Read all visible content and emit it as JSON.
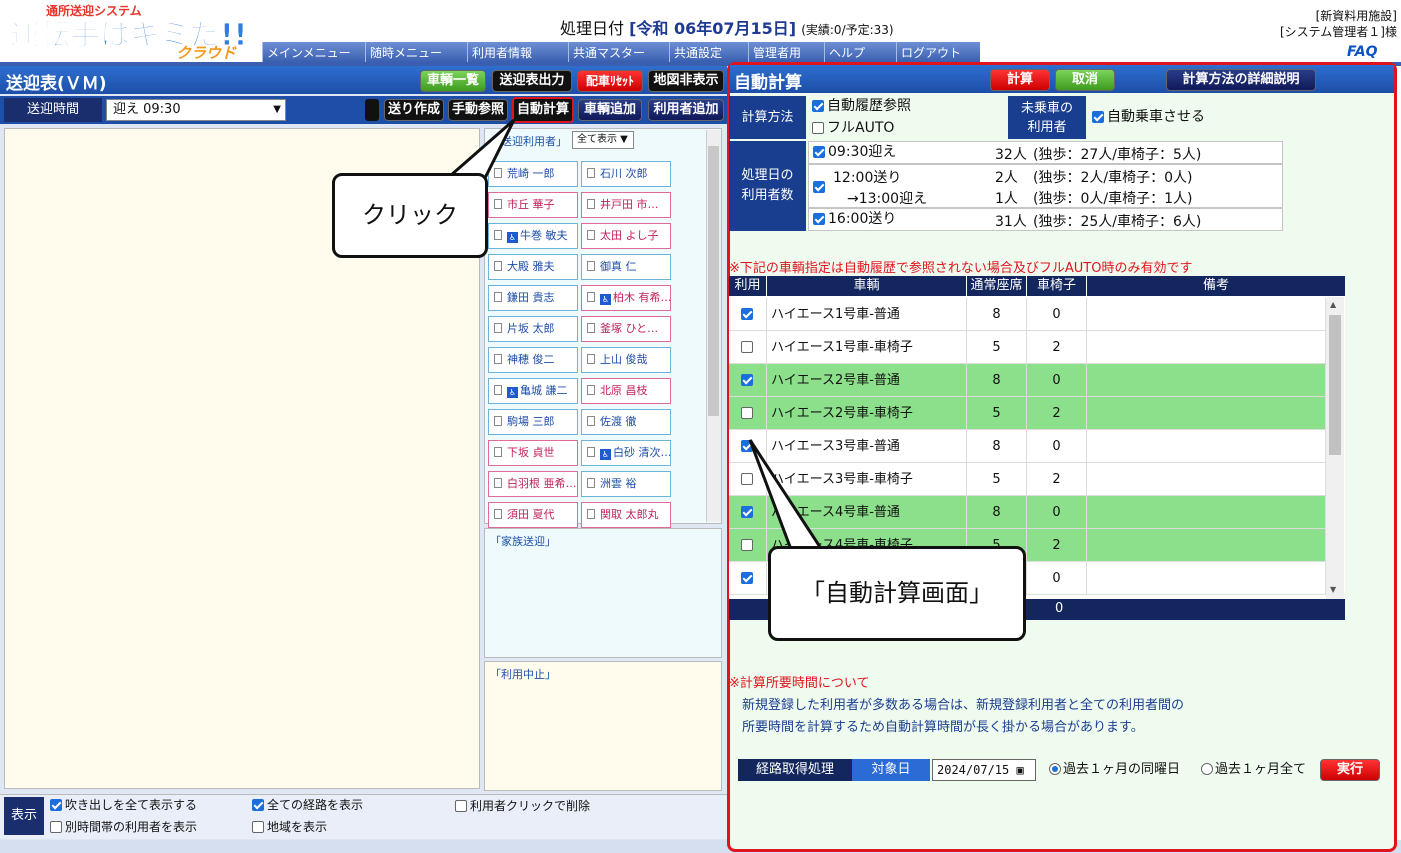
{
  "header": {
    "logo_text_top": "通所送迎システム",
    "logo_text_main": "運転手はキミだ!!",
    "logo_text_sub": "クラウド",
    "processing_label": "処理日付",
    "processing_date": "[令和 06年07月15日]",
    "processing_stats": "(実績:0/予定:33)",
    "facility": "[新資料用施設]",
    "user": "[システム管理者１]様",
    "faq": "FAQ",
    "menu": [
      "メインメニュー",
      "随時メニュー",
      "利用者情報",
      "共通マスター",
      "共通設定",
      "管理者用",
      "ヘルプ",
      "ログアウト"
    ]
  },
  "left": {
    "title": "送迎表(ＶＭ)",
    "top_buttons": [
      "車輌一覧",
      "送迎表出力",
      "配車ﾘｾｯﾄ",
      "地図非表示"
    ],
    "time_label": "送迎時間",
    "time_value": "迎え 09:30",
    "action_buttons": [
      "送り作成",
      "手動参照",
      "自動計算",
      "車輌追加",
      "利用者追加"
    ],
    "user_list_label": "「送迎利用者」",
    "filter_value": "全て表示",
    "users": [
      {
        "name": "荒崎 一郎",
        "style": "blue"
      },
      {
        "name": "石川 次郎",
        "style": "blue"
      },
      {
        "name": "市丘 華子",
        "style": "pink"
      },
      {
        "name": "井戸田 市…",
        "style": "pink"
      },
      {
        "name": "牛巻 敏夫",
        "style": "blue",
        "wc": true
      },
      {
        "name": "太田 よし子",
        "style": "pink"
      },
      {
        "name": "大殿 雅夫",
        "style": "blue"
      },
      {
        "name": "御真 仁",
        "style": "blue"
      },
      {
        "name": "鎌田 貴志",
        "style": "blue"
      },
      {
        "name": "柏木 有希…",
        "style": "pink",
        "wc": true
      },
      {
        "name": "片坂 太郎",
        "style": "blue"
      },
      {
        "name": "釜塚 ひと…",
        "style": "pink"
      },
      {
        "name": "神穂 俊二",
        "style": "blue"
      },
      {
        "name": "上山 俊哉",
        "style": "blue"
      },
      {
        "name": "亀城 謙二",
        "style": "blue",
        "wc": true
      },
      {
        "name": "北原 昌枝",
        "style": "pink"
      },
      {
        "name": "駒場 三郎",
        "style": "blue"
      },
      {
        "name": "佐渡 徹",
        "style": "blue"
      },
      {
        "name": "下坂 貞世",
        "style": "pink"
      },
      {
        "name": "白砂 清次…",
        "style": "blue",
        "wc": true
      },
      {
        "name": "白羽根 亜希…",
        "style": "pink"
      },
      {
        "name": "洲雲 裕",
        "style": "blue"
      },
      {
        "name": "須田 夏代",
        "style": "pink"
      },
      {
        "name": "関取 太郎丸",
        "style": "pink"
      }
    ],
    "family_label": "「家族送迎」",
    "stop_label": "「利用中止」",
    "display_label": "表示",
    "options": [
      {
        "label": "吹き出しを全て表示する",
        "checked": true
      },
      {
        "label": "別時間帯の利用者を表示",
        "checked": false
      },
      {
        "label": "全ての経路を表示",
        "checked": true
      },
      {
        "label": "地域を表示",
        "checked": false
      },
      {
        "label": "利用者クリックで削除",
        "checked": false
      }
    ]
  },
  "right": {
    "title": "自動計算",
    "btn_calc": "計算",
    "btn_cancel": "取消",
    "btn_detail": "計算方法の詳細説明",
    "method_label": "計算方法",
    "method_auto_history": "自動履歴参照",
    "method_full_auto": "フルAUTO",
    "unboarded_label_1": "未乗車の",
    "unboarded_label_2": "利用者",
    "auto_board": "自動乗車させる",
    "count_label_1": "処理日の",
    "count_label_2": "利用者数",
    "counts": [
      {
        "slot": "09:30迎え",
        "num": "32人",
        "detail": "(独歩：27人/車椅子：5人)"
      },
      {
        "slot": "12:00送り",
        "num": "2人",
        "detail": "(独歩：2人/車椅子：0人)"
      },
      {
        "slot": "→13:00迎え",
        "num": "1人",
        "detail": "(独歩：0人/車椅子：1人)"
      },
      {
        "slot": "16:00送り",
        "num": "31人",
        "detail": "(独歩：25人/車椅子：6人)"
      }
    ],
    "note_vehicle": "※下記の車輌指定は自動履歴で参照されない場合及びフルAUTO時のみ有効です",
    "table_headers": [
      "利用",
      "車輌",
      "通常座席",
      "車椅子",
      "備考"
    ],
    "vehicles": [
      {
        "use": true,
        "name": "ハイエース1号車-普通",
        "seats": "8",
        "wheel": "0",
        "green": false
      },
      {
        "use": false,
        "name": "ハイエース1号車-車椅子",
        "seats": "5",
        "wheel": "2",
        "green": false
      },
      {
        "use": true,
        "name": "ハイエース2号車-普通",
        "seats": "8",
        "wheel": "0",
        "green": true
      },
      {
        "use": false,
        "name": "ハイエース2号車-車椅子",
        "seats": "5",
        "wheel": "2",
        "green": true
      },
      {
        "use": true,
        "name": "ハイエース3号車-普通",
        "seats": "8",
        "wheel": "0",
        "green": false
      },
      {
        "use": false,
        "name": "ハイエース3号車-車椅子",
        "seats": "5",
        "wheel": "2",
        "green": false
      },
      {
        "use": true,
        "name": "ハイエース4号車-普通",
        "seats": "8",
        "wheel": "0",
        "green": true
      },
      {
        "use": false,
        "name": "ハイエース4号車-車椅子",
        "seats": "5",
        "wheel": "2",
        "green": true
      },
      {
        "use": true,
        "name": "",
        "seats": "",
        "wheel": "0",
        "green": false
      }
    ],
    "footer_total": "0",
    "note_time_title": "※計算所要時間について",
    "note_time_1": "新規登録した利用者が多数ある場合は、新規登録利用者と全ての利用者間の",
    "note_time_2": "所要時間を計算するため自動計算時間が長く掛かる場合があります。",
    "route_label": "経路取得処理",
    "target_label": "対象日",
    "target_date": "2024/07/15",
    "radio_same_weekday": "過去１ヶ月の同曜日",
    "radio_all": "過去１ヶ月全て",
    "btn_run": "実行"
  },
  "callouts": {
    "click": "クリック",
    "screen": "「自動計算画面」"
  }
}
